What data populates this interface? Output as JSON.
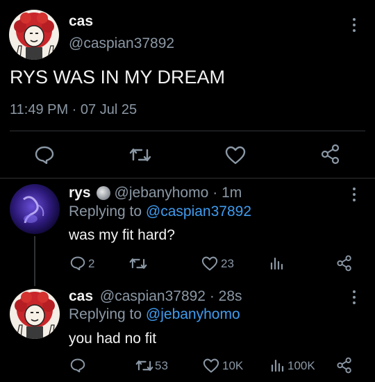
{
  "main_tweet": {
    "display_name": "cas",
    "handle": "@caspian37892",
    "text": "RYS WAS IN MY DREAM",
    "timestamp": "11:49 PM · 07 Jul 25",
    "actions": [
      "reply-icon",
      "retweet-icon",
      "like-icon",
      "share-icon"
    ]
  },
  "reply_1": {
    "display_name": "rys",
    "badge": "moon-badge-icon",
    "handle": "@jebanyhomo",
    "time": "· 1m",
    "replying_prefix": "Replying to",
    "replying_to": "@caspian37892",
    "text": "was my fit hard?",
    "reply_count": "2",
    "retweet_count": "",
    "like_count": "23",
    "views_count": ""
  },
  "reply_2": {
    "display_name": "cas",
    "handle": "@caspian37892",
    "time": "· 28s",
    "replying_prefix": "Replying to",
    "replying_to": "@jebanyhomo",
    "text": "you had no fit",
    "reply_count": "",
    "retweet_count": "53",
    "like_count": "10K",
    "views_count": "100K"
  },
  "colors": {
    "background": "#000000",
    "text": "#e7e9ea",
    "muted": "#8b98a5",
    "link": "#3f9cf0",
    "divider": "#2f3336"
  }
}
